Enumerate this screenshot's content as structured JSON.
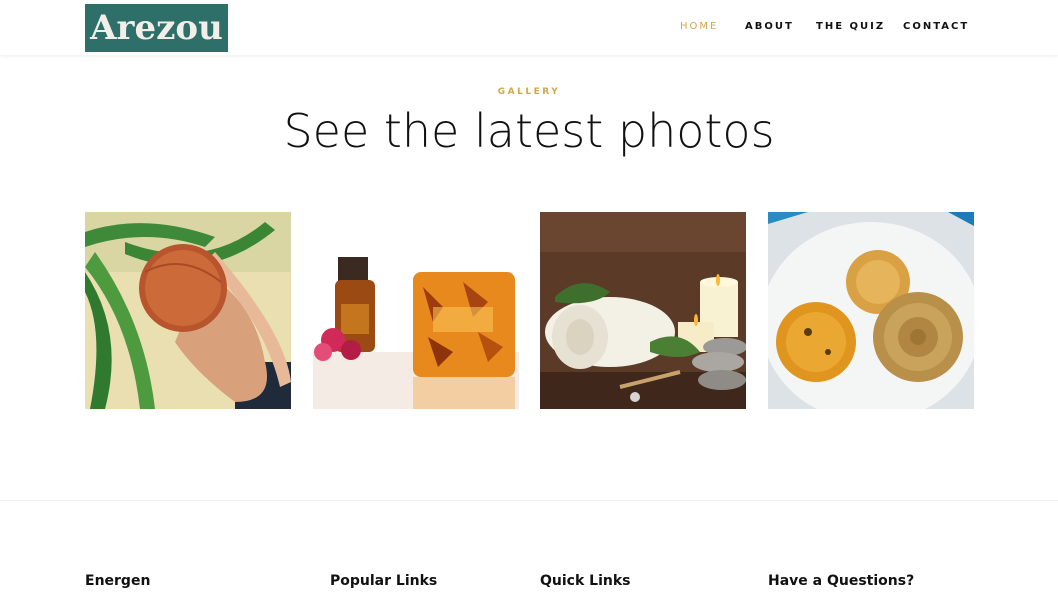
{
  "header": {
    "logo_text": "Arezou",
    "nav": [
      {
        "label": "HOME",
        "active": true
      },
      {
        "label": "ABOUT",
        "active": false
      },
      {
        "label": "THE QUIZ",
        "active": false
      },
      {
        "label": "CONTACT",
        "active": false
      }
    ]
  },
  "gallery": {
    "eyebrow": "GALLERY",
    "title": "See the latest photos",
    "photos": [
      {
        "subject": "hand holding round soap among palm leaves"
      },
      {
        "subject": "essential oil bottle, rose petals and amber soap bar"
      },
      {
        "subject": "rolled towel, candles and spa stones"
      },
      {
        "subject": "amber glycerin soaps on white plate"
      }
    ]
  },
  "footer": {
    "columns": [
      {
        "heading": "Energen"
      },
      {
        "heading": "Popular Links"
      },
      {
        "heading": "Quick Links"
      },
      {
        "heading": "Have a Questions?"
      }
    ]
  },
  "colors": {
    "accent": "#d3a64a",
    "logo_bg": "#2f6f6a",
    "text": "#111111"
  }
}
